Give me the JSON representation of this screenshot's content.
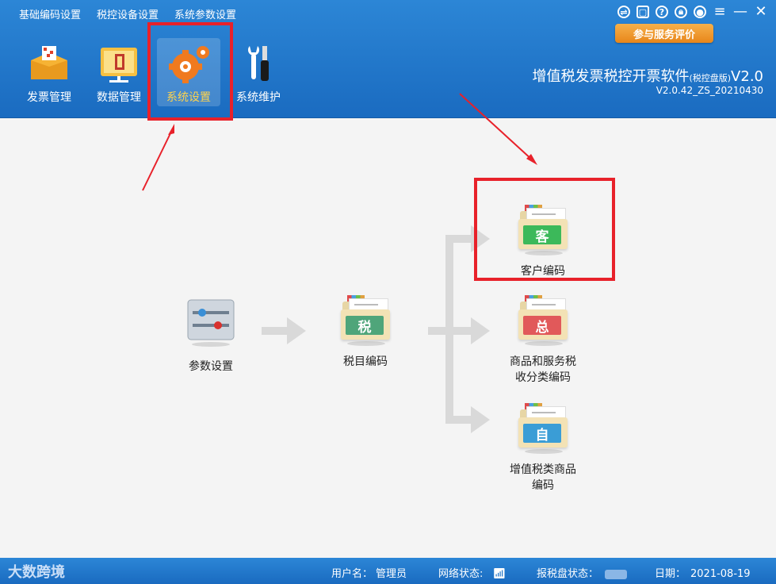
{
  "menu": [
    "基础编码设置",
    "税控设备设置",
    "系统参数设置"
  ],
  "window_icons": [
    "exchange-icon",
    "document-icon",
    "help-icon",
    "lock-icon",
    "user-icon",
    "hamburger-icon",
    "minimize-icon",
    "close-icon"
  ],
  "eval_button": "参与服务评价",
  "toolbar": [
    {
      "label": "发票管理",
      "icon": "invoice-box-icon"
    },
    {
      "label": "数据管理",
      "icon": "data-folder-icon"
    },
    {
      "label": "系统设置",
      "icon": "gear-icon"
    },
    {
      "label": "系统维护",
      "icon": "tools-icon"
    }
  ],
  "app": {
    "title_main": "增值税发票税控开票软件",
    "title_small": "(税控盘版)",
    "title_suffix": "V2.0",
    "version": "V2.0.42_ZS_20210430"
  },
  "flow": {
    "param": "参数设置",
    "tax_item": {
      "badge": "税",
      "label": "税目编码",
      "color": "#4fa57a"
    },
    "customer": {
      "badge": "客",
      "label": "客户编码",
      "color": "#3cb95a"
    },
    "goods": {
      "badge": "总",
      "label1": "商品和服务税",
      "label2": "收分类编码",
      "color": "#e1595a"
    },
    "vat_goods": {
      "badge": "自",
      "label1": "增值税类商品",
      "label2": "编码",
      "color": "#3a9dd6"
    }
  },
  "status": {
    "brand": "大数跨境",
    "user_label": "用户名：",
    "user": "管理员",
    "network_label": "网络状态:",
    "disk_label": "报税盘状态：",
    "date_label": "日期：",
    "date": "2021-08-19"
  },
  "colors": {
    "header": "#1f75cb",
    "annotation": "#e8212a",
    "active_label": "#ffd34d"
  }
}
